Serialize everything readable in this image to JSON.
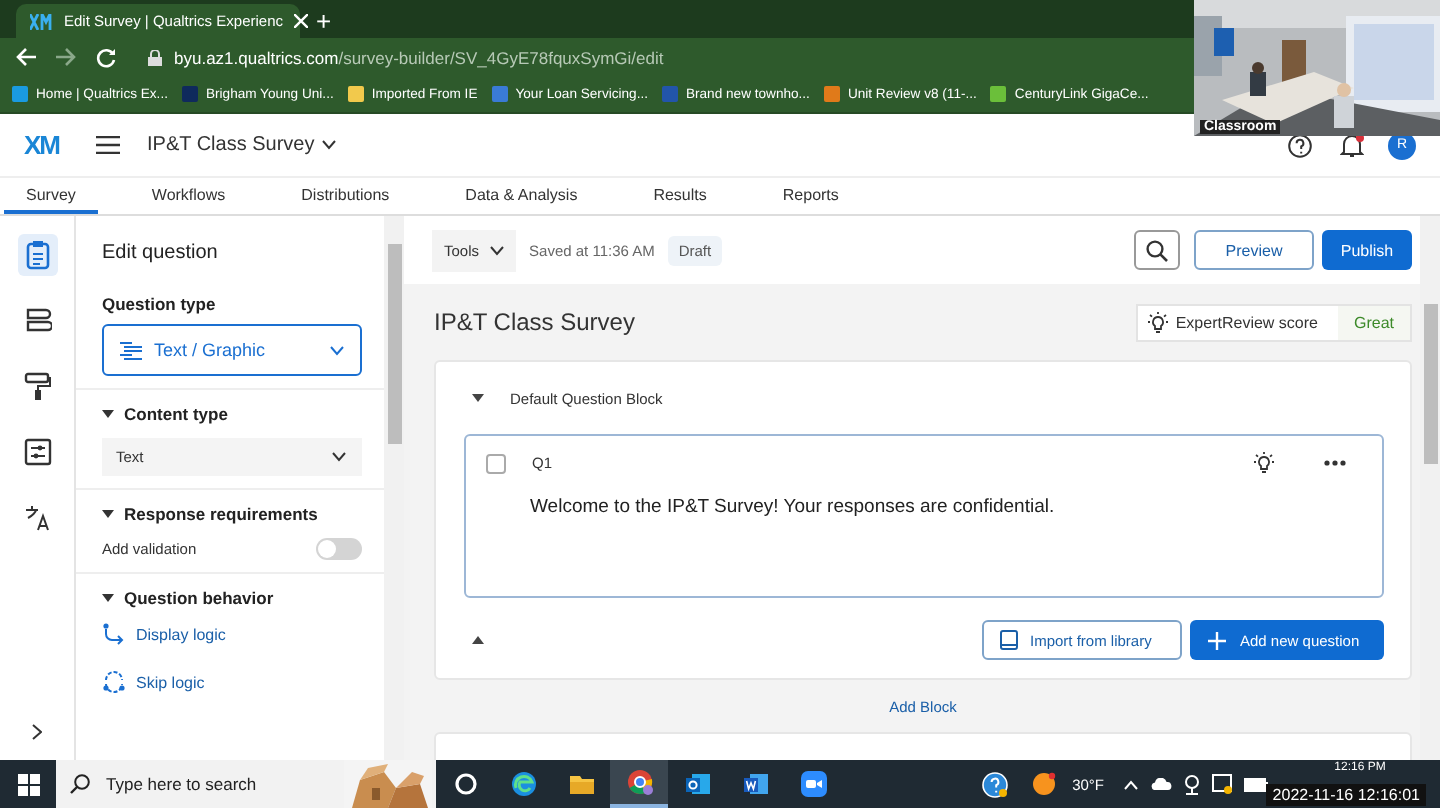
{
  "browser": {
    "tabs": [
      {
        "title": "Edit Survey | Qualtrics Experienc",
        "selected": true
      }
    ],
    "new_tab": "+",
    "url_domain": "byu.az1.qualtrics.com",
    "url_path": "/survey-builder/SV_4GyE78fquxSymGi/edit"
  },
  "bookmarks": [
    {
      "label": "Home | Qualtrics Ex...",
      "color": "#1a9be0"
    },
    {
      "label": "Brigham Young Uni...",
      "color": "#0f2a5c"
    },
    {
      "label": "Imported From IE",
      "color": "#f2c94c"
    },
    {
      "label": "Your Loan Servicing...",
      "color": "#3a7bd5"
    },
    {
      "label": "Brand new townho...",
      "color": "#2255aa"
    },
    {
      "label": "Unit Review v8 (11-...",
      "color": "#e07a1a"
    },
    {
      "label": "CenturyLink GigaCe...",
      "color": "#6bbf3a"
    }
  ],
  "camera": {
    "label": "Classroom"
  },
  "header": {
    "logo": "XM",
    "survey_name": "IP&T Class Survey",
    "notification": true,
    "avatar": "R"
  },
  "nav_tabs": [
    {
      "label": "Survey",
      "selected": true
    },
    {
      "label": "Workflows",
      "selected": false
    },
    {
      "label": "Distributions",
      "selected": false
    },
    {
      "label": "Data & Analysis",
      "selected": false
    },
    {
      "label": "Results",
      "selected": false
    },
    {
      "label": "Reports",
      "selected": false
    }
  ],
  "rail": [
    {
      "kind": "clipboard",
      "selected": true
    },
    {
      "kind": "blocks",
      "selected": false
    },
    {
      "kind": "paint",
      "selected": false
    },
    {
      "kind": "options",
      "selected": false
    },
    {
      "kind": "translate",
      "selected": false
    }
  ],
  "panel": {
    "title": "Edit question",
    "question_type_label": "Question type",
    "question_type": "Text / Graphic",
    "sections": [
      {
        "title": "Content type",
        "expanded": true,
        "items": [
          {
            "kind": "dropdown",
            "label": "Text"
          }
        ]
      },
      {
        "title": "Response requirements",
        "expanded": true,
        "items": [
          {
            "kind": "toggle",
            "label": "Add validation",
            "on": false
          }
        ]
      },
      {
        "title": "Question behavior",
        "expanded": true,
        "items": [
          {
            "kind": "link",
            "label": "Display logic"
          },
          {
            "kind": "link",
            "label": "Skip logic"
          }
        ]
      }
    ]
  },
  "toolbar": {
    "tools": "Tools",
    "saved": "Saved at 11:36 AM",
    "status": "Draft",
    "preview": "Preview",
    "publish": "Publish"
  },
  "survey": {
    "title": "IP&T Class Survey",
    "expert_label": "ExpertReview score",
    "expert_value": "Great",
    "blocks": [
      {
        "name": "Default Question Block",
        "expanded": true,
        "questions": [
          {
            "number": "Q1",
            "text": "Welcome to the IP&T Survey! Your responses are confidential.",
            "checked": false
          }
        ]
      }
    ],
    "import": "Import from library",
    "add_question": "Add new question",
    "add_block": "Add Block"
  },
  "taskbar": {
    "search": "Type here to search",
    "apps": [
      {
        "kind": "cortana",
        "active": false
      },
      {
        "kind": "edge",
        "active": false
      },
      {
        "kind": "explorer",
        "active": false
      },
      {
        "kind": "chrome",
        "active": true
      },
      {
        "kind": "outlook",
        "active": false
      },
      {
        "kind": "word",
        "active": false
      },
      {
        "kind": "zoom",
        "active": false
      }
    ],
    "weather": "30°F",
    "time": "12:16 PM",
    "timestamp": "2022-11-16 12:16:01"
  }
}
